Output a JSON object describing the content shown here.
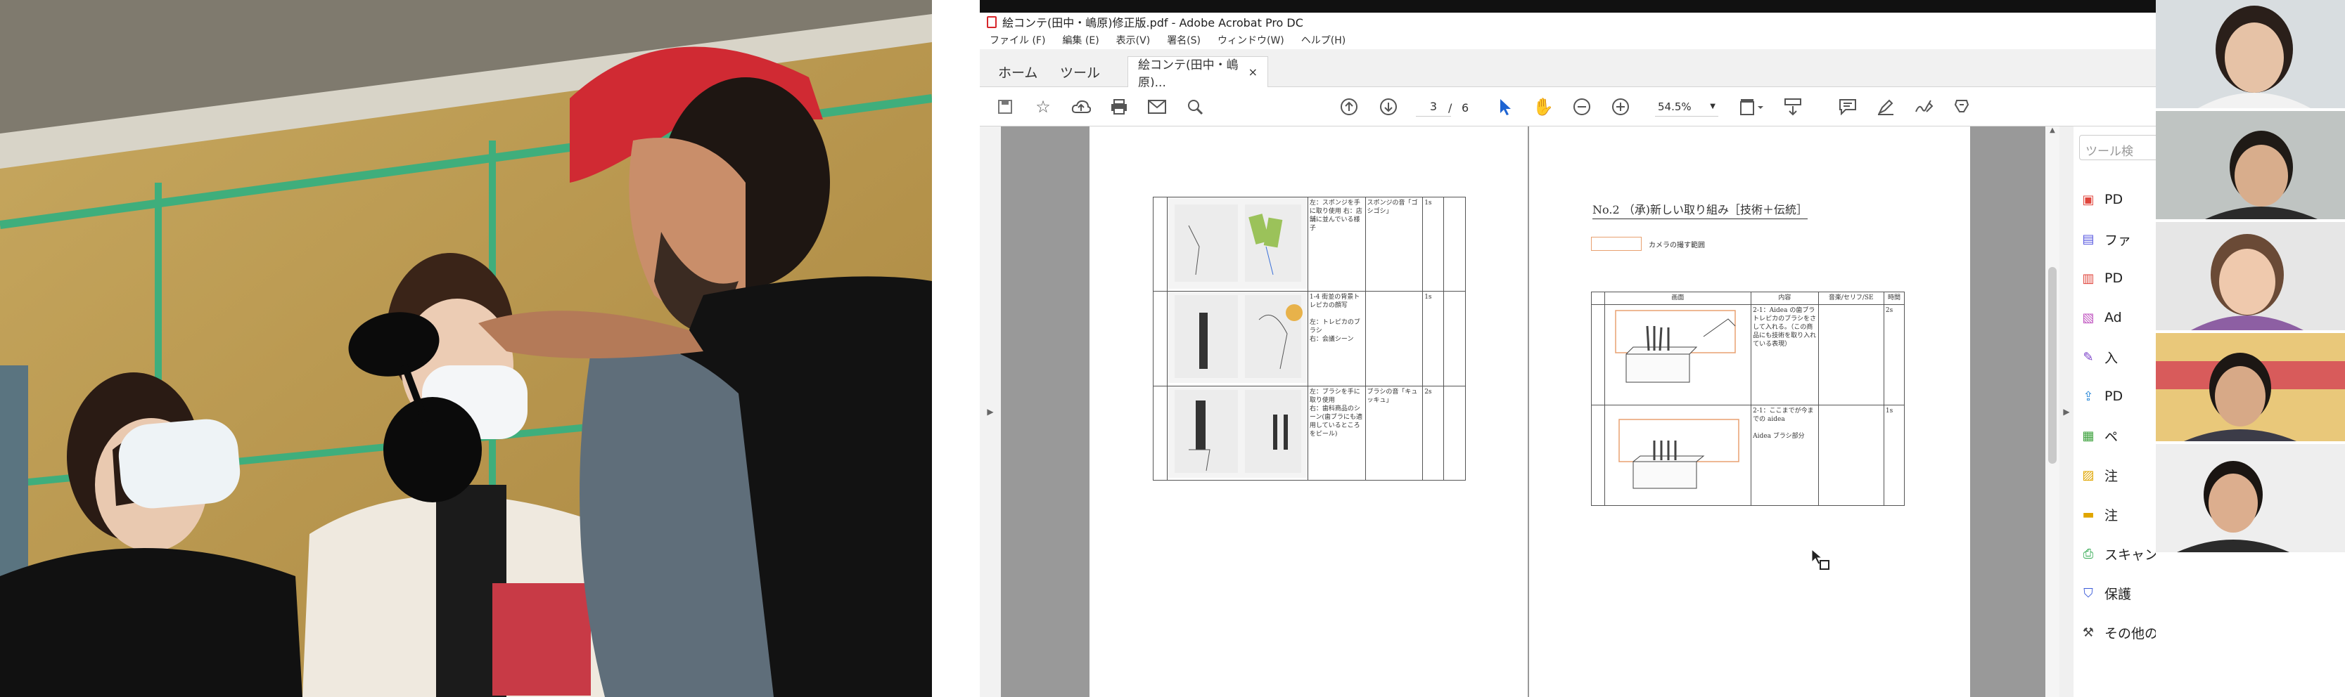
{
  "app": {
    "title": "絵コンテ(田中・嶋原)修正版.pdf - Adobe Acrobat Pro DC",
    "menu": [
      "ファイル (F)",
      "編集 (E)",
      "表示(V)",
      "署名(S)",
      "ウィンドウ(W)",
      "ヘルプ(H)"
    ],
    "tabs": {
      "home": "ホーム",
      "tools": "ツール",
      "doc": "絵コンテ(田中・嶋原)...",
      "close": "×"
    },
    "page_current": "3",
    "page_sep": "/",
    "page_total": "6",
    "zoom": "54.5%"
  },
  "icons": [
    "save-icon",
    "bookmark-star-icon",
    "cloud-upload-icon",
    "print-icon",
    "email-icon",
    "find-icon",
    "page-up-icon",
    "page-down-icon",
    "select-arrow-icon",
    "hand-icon",
    "zoom-out-icon",
    "zoom-in-icon",
    "page-fit-icon",
    "scroll-mode-icon",
    "comment-icon",
    "highlight-icon",
    "sign-icon",
    "stamp-icon",
    "pdf-file-icon"
  ],
  "left_page": {
    "rows": [
      {
        "desc": "左：スポンジを手に取り使用\n右：店舗に並んでいる様子",
        "sound": "スポンジの音「ゴシゴシ」",
        "time": "1s"
      },
      {
        "desc": "1-4 街並の背景トレピカの顔写\n\n左：トレピカのブラシ\n右：会議シーン",
        "sound": "",
        "time": "1s"
      },
      {
        "desc": "左：ブラシを手に取り使用\n右：歯科商品のシーン(歯ブラにも適用しているところをピール)",
        "sound": "ブラシの音「キュッキュ」",
        "time": "2s"
      }
    ]
  },
  "right_page": {
    "heading": "No.2 （承)新しい取り組み［技術＋伝統］",
    "legend": "カメラの撮す範囲",
    "headers": [
      "画面",
      "内容",
      "音楽/セリフ/SE",
      "時間"
    ],
    "rows": [
      {
        "content": "2-1：Aidea の歯ブラ\nトレピカのブラシをさして入れる。（この商品にも技術を取り入れている表現）",
        "time": "2s"
      },
      {
        "content": "2-1：ここまでが今までの aidea\n\nAidea ブラシ部分",
        "time": "1s"
      }
    ]
  },
  "tools_panel": {
    "search_placeholder": "ツール検",
    "items": [
      {
        "label": "PD",
        "icon": "create-pdf-icon",
        "color": "#e0463d"
      },
      {
        "label": "ファ",
        "icon": "combine-files-icon",
        "color": "#5a5ae0"
      },
      {
        "label": "PD",
        "icon": "organize-pages-icon",
        "color": "#e0463d"
      },
      {
        "label": "Ad",
        "icon": "edit-pdf-icon",
        "color": "#c055c0"
      },
      {
        "label": "入",
        "icon": "fill-sign-icon",
        "color": "#7a3fc8"
      },
      {
        "label": "PD",
        "icon": "export-pdf-icon",
        "color": "#2e8ad8"
      },
      {
        "label": "ペ",
        "icon": "protect-pages-icon",
        "color": "#3aa03a"
      },
      {
        "label": "注",
        "icon": "comment-tool-icon",
        "color": "#e0a500"
      },
      {
        "label": "注",
        "icon": "comment-bubble-icon",
        "color": "#e0a500"
      },
      {
        "label": "スキャンと OCR",
        "icon": "scan-ocr-icon",
        "color": "#2ea84e"
      },
      {
        "label": "保護",
        "icon": "shield-icon",
        "color": "#3a5ad8"
      },
      {
        "label": "その他のツール",
        "icon": "more-tools-icon",
        "color": "#444"
      }
    ]
  },
  "colors": {
    "acrobat_red": "#d7262b",
    "tab_bg": "#f1f1f1",
    "viewer_bg": "#999999"
  }
}
